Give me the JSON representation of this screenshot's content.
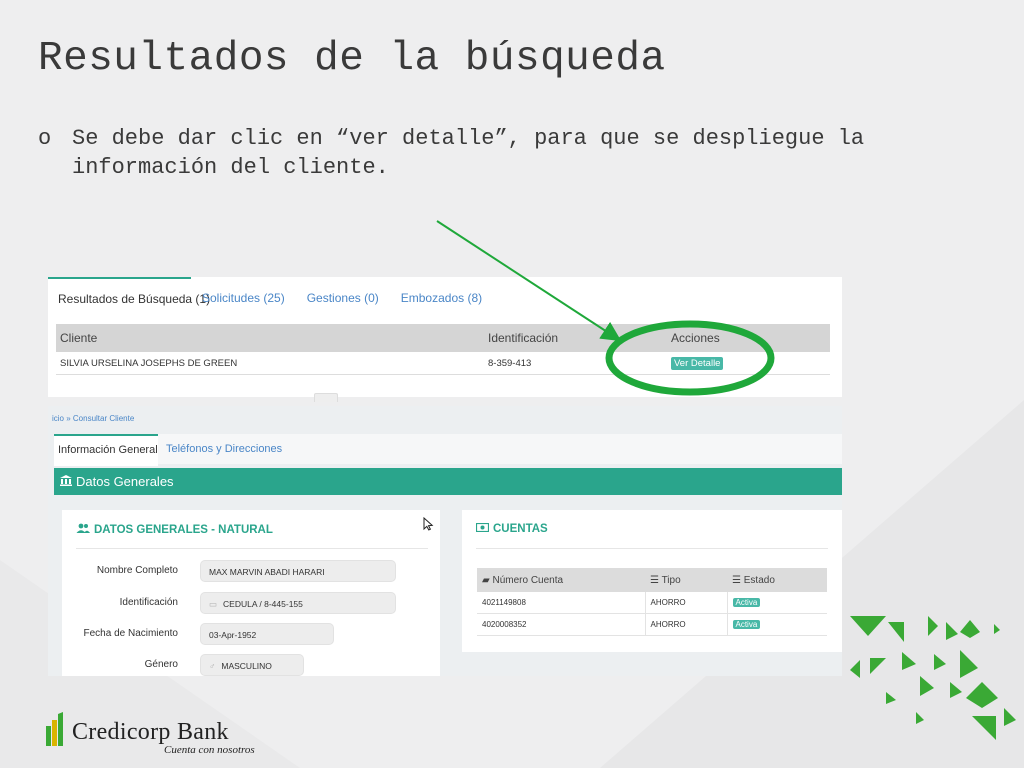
{
  "slide": {
    "title": "Resultados de la búsqueda",
    "bullet_mark": "o",
    "bullet_text": "Se debe dar clic en “ver detalle”, para que se despliegue la información del cliente."
  },
  "search_panel": {
    "tabs": [
      {
        "label": "Resultados de Búsqueda (1)",
        "active": true
      },
      {
        "label": "Solicitudes (25)",
        "active": false
      },
      {
        "label": "Gestiones (0)",
        "active": false
      },
      {
        "label": "Embozados (8)",
        "active": false
      }
    ],
    "columns": [
      "Cliente",
      "Identificación",
      "Acciones"
    ],
    "row": {
      "cliente": "SILVIA URSELINA JOSEPHS DE GREEN",
      "identificacion": "8-359-413",
      "accion": "Ver Detalle"
    }
  },
  "client_panel": {
    "breadcrumb": "icio  »  Consultar Cliente",
    "tabs": [
      {
        "label": "Información General",
        "active": true
      },
      {
        "label": "Teléfonos y Direcciones",
        "active": false
      }
    ],
    "section_title": "Datos Generales",
    "datos_card": {
      "title": "DATOS GENERALES - NATURAL",
      "fields": [
        {
          "label": "Nombre Completo",
          "value": "MAX MARVIN ABADI HARARI",
          "icon": ""
        },
        {
          "label": "Identificación",
          "value": "CEDULA / 8-445-155",
          "icon": "id-card-icon"
        },
        {
          "label": "Fecha de Nacimiento",
          "value": "03-Apr-1952",
          "icon": ""
        },
        {
          "label": "Género",
          "value": "MASCULINO",
          "icon": "gender-icon"
        }
      ]
    },
    "cuentas_card": {
      "title": "CUENTAS",
      "columns": [
        "Número Cuenta",
        "Tipo",
        "Estado"
      ],
      "rows": [
        {
          "numero": "4021149808",
          "tipo": "AHORRO",
          "estado": "Activa"
        },
        {
          "numero": "4020008352",
          "tipo": "AHORRO",
          "estado": "Activa"
        }
      ]
    }
  },
  "branding": {
    "logo_text": "Credicorp Bank",
    "logo_tagline": "Cuenta con nosotros"
  },
  "colors": {
    "teal": "#2aa58c",
    "link_blue": "#4a86c7",
    "highlight_green": "#1fa83a",
    "logo_green": "#3aa935",
    "logo_gold": "#d9b400"
  }
}
